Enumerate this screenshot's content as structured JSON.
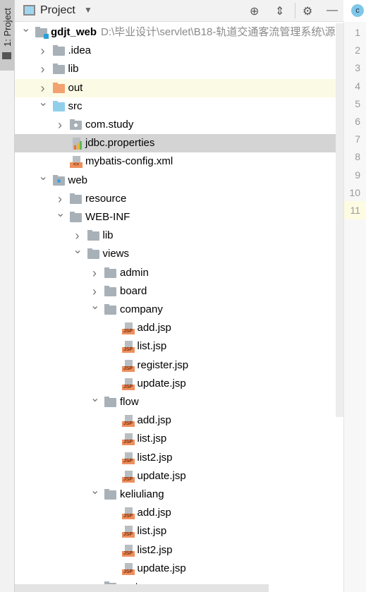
{
  "toolwindow_tab": "1: Project",
  "header": {
    "title": "Project",
    "icons": [
      "locate-icon",
      "collapse-all-icon",
      "gear-icon",
      "minimize-icon"
    ],
    "editor_tab_icon": "c"
  },
  "tree": [
    {
      "label": "gdjt_web",
      "path": "D:\\毕业设计\\servlet\\B18-轨道交通客流管理系统\\源",
      "level": 0,
      "type": "module",
      "expanded": true
    },
    {
      "label": ".idea",
      "level": 1,
      "type": "folder",
      "expanded": false
    },
    {
      "label": "lib",
      "level": 1,
      "type": "folder",
      "expanded": false
    },
    {
      "label": "out",
      "level": 1,
      "type": "folder-orange",
      "expanded": false,
      "highlight": true
    },
    {
      "label": "src",
      "level": 1,
      "type": "folder-blue",
      "expanded": true
    },
    {
      "label": "com.study",
      "level": 2,
      "type": "package",
      "expanded": false
    },
    {
      "label": "jdbc.properties",
      "level": 2,
      "type": "properties",
      "selected": true
    },
    {
      "label": "mybatis-config.xml",
      "level": 2,
      "type": "xml"
    },
    {
      "label": "web",
      "level": 1,
      "type": "web",
      "expanded": true
    },
    {
      "label": "resource",
      "level": 2,
      "type": "folder",
      "expanded": false
    },
    {
      "label": "WEB-INF",
      "level": 2,
      "type": "folder",
      "expanded": true
    },
    {
      "label": "lib",
      "level": 3,
      "type": "folder",
      "expanded": false
    },
    {
      "label": "views",
      "level": 3,
      "type": "folder",
      "expanded": true
    },
    {
      "label": "admin",
      "level": 4,
      "type": "folder",
      "expanded": false
    },
    {
      "label": "board",
      "level": 4,
      "type": "folder",
      "expanded": false
    },
    {
      "label": "company",
      "level": 4,
      "type": "folder",
      "expanded": true
    },
    {
      "label": "add.jsp",
      "level": 5,
      "type": "jsp"
    },
    {
      "label": "list.jsp",
      "level": 5,
      "type": "jsp"
    },
    {
      "label": "register.jsp",
      "level": 5,
      "type": "jsp"
    },
    {
      "label": "update.jsp",
      "level": 5,
      "type": "jsp"
    },
    {
      "label": "flow",
      "level": 4,
      "type": "folder",
      "expanded": true
    },
    {
      "label": "add.jsp",
      "level": 5,
      "type": "jsp"
    },
    {
      "label": "list.jsp",
      "level": 5,
      "type": "jsp"
    },
    {
      "label": "list2.jsp",
      "level": 5,
      "type": "jsp"
    },
    {
      "label": "update.jsp",
      "level": 5,
      "type": "jsp"
    },
    {
      "label": "keliuliang",
      "level": 4,
      "type": "folder",
      "expanded": true
    },
    {
      "label": "add.jsp",
      "level": 5,
      "type": "jsp"
    },
    {
      "label": "list.jsp",
      "level": 5,
      "type": "jsp"
    },
    {
      "label": "list2.jsp",
      "level": 5,
      "type": "jsp"
    },
    {
      "label": "update.jsp",
      "level": 5,
      "type": "jsp"
    },
    {
      "label": "route",
      "level": 4,
      "type": "folder",
      "expanded": false
    }
  ],
  "jsp_badge": "JSP",
  "xml_badge": "<>",
  "gutter": {
    "lines": [
      "1",
      "2",
      "3",
      "4",
      "5",
      "6",
      "7",
      "8",
      "9",
      "10",
      "11"
    ],
    "current": "11"
  }
}
